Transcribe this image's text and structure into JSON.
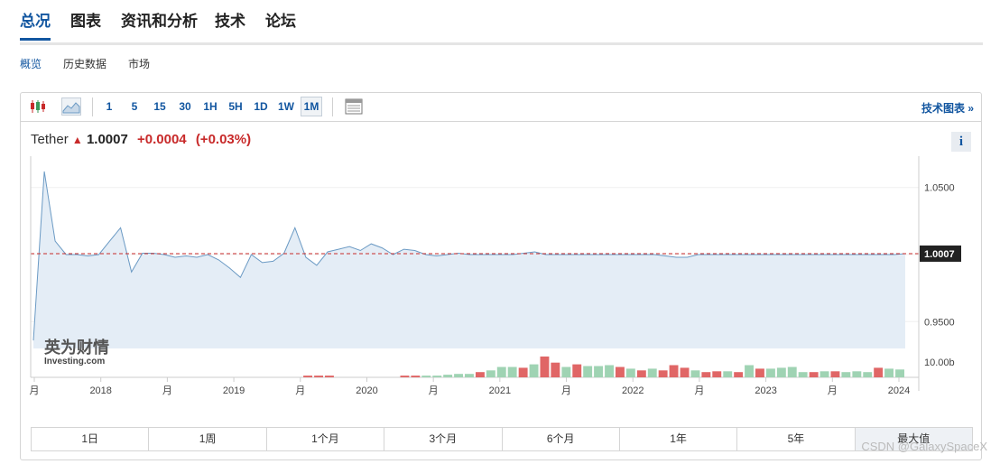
{
  "main_tabs": [
    "总况",
    "图表",
    "资讯和分析",
    "技术",
    "论坛"
  ],
  "sub_tabs": [
    "概览",
    "历史数据",
    "市场"
  ],
  "toolbar": {
    "intervals": [
      "1",
      "5",
      "15",
      "30",
      "1H",
      "5H",
      "1D",
      "1W",
      "1M"
    ],
    "active_interval": "1M",
    "tech_chart_label": "技术图表 »"
  },
  "quote": {
    "name": "Tether",
    "price": "1.0007",
    "change": "+0.0004",
    "change_pct": "(+0.03%)"
  },
  "info_label": "i",
  "logo": {
    "cn": "英为财情",
    "en": "Investing.com"
  },
  "chart_data": {
    "type": "area",
    "y_ticks": [
      "1.0500",
      "0.9500"
    ],
    "current_value_label": "1.0007",
    "volume_tick": "10.00b",
    "x_tick_labels": [
      "月",
      "2018",
      "月",
      "2019",
      "月",
      "2020",
      "月",
      "2021",
      "月",
      "2022",
      "月",
      "2023",
      "月",
      "2024"
    ],
    "ylim": [
      0.93,
      1.07
    ],
    "current_value": 1.0007,
    "series": [
      {
        "values": [
          0.936,
          1.062,
          1.01,
          1.0,
          1.0,
          0.999,
          1.0,
          1.01,
          1.02,
          0.987,
          1.001,
          1.001,
          1.0,
          0.998,
          0.999,
          0.998,
          1.0,
          0.996,
          0.99,
          0.983,
          1.0,
          0.994,
          0.995,
          1.001,
          1.02,
          0.998,
          0.992,
          1.002,
          1.004,
          1.006,
          1.003,
          1.008,
          1.005,
          1.0,
          1.004,
          1.003,
          1.0,
          0.999,
          1.0,
          1.001,
          1.0,
          1.0,
          1.0,
          1.0,
          1.0,
          1.001,
          1.002,
          1.0,
          1.0,
          1.0,
          1.0,
          1.0,
          1.0,
          1.0,
          1.0,
          1.0,
          1.0,
          1.0,
          0.999,
          0.998,
          0.998,
          1.0,
          1.0,
          1.0,
          1.0,
          1.0,
          1.0,
          1.0,
          1.0,
          1.0,
          1.0,
          1.0,
          1.0,
          1.0,
          1.0,
          1.0,
          1.0,
          1.0,
          1.0,
          1.0,
          1.0007
        ],
        "color": "#6b9ac4"
      }
    ],
    "volume": [
      {
        "v": 0,
        "up": true
      },
      {
        "v": 0,
        "up": true
      },
      {
        "v": 0,
        "up": true
      },
      {
        "v": 0,
        "up": true
      },
      {
        "v": 0,
        "up": true
      },
      {
        "v": 0,
        "up": true
      },
      {
        "v": 0,
        "up": true
      },
      {
        "v": 0,
        "up": true
      },
      {
        "v": 0,
        "up": true
      },
      {
        "v": 0,
        "up": true
      },
      {
        "v": 0,
        "up": true
      },
      {
        "v": 0,
        "up": true
      },
      {
        "v": 0,
        "up": true
      },
      {
        "v": 0,
        "up": true
      },
      {
        "v": 0,
        "up": true
      },
      {
        "v": 0,
        "up": true
      },
      {
        "v": 0,
        "up": true
      },
      {
        "v": 0,
        "up": true
      },
      {
        "v": 0,
        "up": true
      },
      {
        "v": 0,
        "up": true
      },
      {
        "v": 0,
        "up": true
      },
      {
        "v": 0,
        "up": true
      },
      {
        "v": 0,
        "up": true
      },
      {
        "v": 0,
        "up": true
      },
      {
        "v": 0,
        "up": true
      },
      {
        "v": 0.1,
        "up": false
      },
      {
        "v": 0.1,
        "up": false
      },
      {
        "v": 0.1,
        "up": false
      },
      {
        "v": 0,
        "up": true
      },
      {
        "v": 0,
        "up": true
      },
      {
        "v": 0,
        "up": true
      },
      {
        "v": 0,
        "up": true
      },
      {
        "v": 0,
        "up": true
      },
      {
        "v": 0,
        "up": true
      },
      {
        "v": 0.1,
        "up": false
      },
      {
        "v": 0.1,
        "up": false
      },
      {
        "v": 0.1,
        "up": true
      },
      {
        "v": 0.1,
        "up": true
      },
      {
        "v": 0.15,
        "up": true
      },
      {
        "v": 0.2,
        "up": true
      },
      {
        "v": 0.2,
        "up": true
      },
      {
        "v": 0.3,
        "up": false
      },
      {
        "v": 0.4,
        "up": true
      },
      {
        "v": 0.6,
        "up": true
      },
      {
        "v": 0.6,
        "up": true
      },
      {
        "v": 0.55,
        "up": false
      },
      {
        "v": 0.75,
        "up": true
      },
      {
        "v": 1.2,
        "up": false
      },
      {
        "v": 0.85,
        "up": false
      },
      {
        "v": 0.6,
        "up": true
      },
      {
        "v": 0.75,
        "up": false
      },
      {
        "v": 0.65,
        "up": true
      },
      {
        "v": 0.65,
        "up": true
      },
      {
        "v": 0.7,
        "up": true
      },
      {
        "v": 0.6,
        "up": false
      },
      {
        "v": 0.5,
        "up": true
      },
      {
        "v": 0.4,
        "up": false
      },
      {
        "v": 0.5,
        "up": true
      },
      {
        "v": 0.4,
        "up": false
      },
      {
        "v": 0.7,
        "up": false
      },
      {
        "v": 0.55,
        "up": false
      },
      {
        "v": 0.4,
        "up": true
      },
      {
        "v": 0.3,
        "up": false
      },
      {
        "v": 0.35,
        "up": false
      },
      {
        "v": 0.35,
        "up": true
      },
      {
        "v": 0.3,
        "up": false
      },
      {
        "v": 0.7,
        "up": true
      },
      {
        "v": 0.5,
        "up": false
      },
      {
        "v": 0.5,
        "up": true
      },
      {
        "v": 0.55,
        "up": true
      },
      {
        "v": 0.6,
        "up": true
      },
      {
        "v": 0.3,
        "up": true
      },
      {
        "v": 0.3,
        "up": false
      },
      {
        "v": 0.35,
        "up": true
      },
      {
        "v": 0.35,
        "up": false
      },
      {
        "v": 0.3,
        "up": true
      },
      {
        "v": 0.35,
        "up": true
      },
      {
        "v": 0.3,
        "up": true
      },
      {
        "v": 0.55,
        "up": false
      },
      {
        "v": 0.5,
        "up": true
      },
      {
        "v": 0.45,
        "up": true
      }
    ],
    "volume_max": 1.3,
    "colors": {
      "up": "#9fd3b3",
      "down": "#e06666",
      "area": "#e4edf6",
      "ref_line": "#c82a2a"
    }
  },
  "range_buttons": [
    "1日",
    "1周",
    "1个月",
    "3个月",
    "6个月",
    "1年",
    "5年",
    "最大值"
  ],
  "active_range": "最大值",
  "watermark": "CSDN @GalaxySpaceX"
}
